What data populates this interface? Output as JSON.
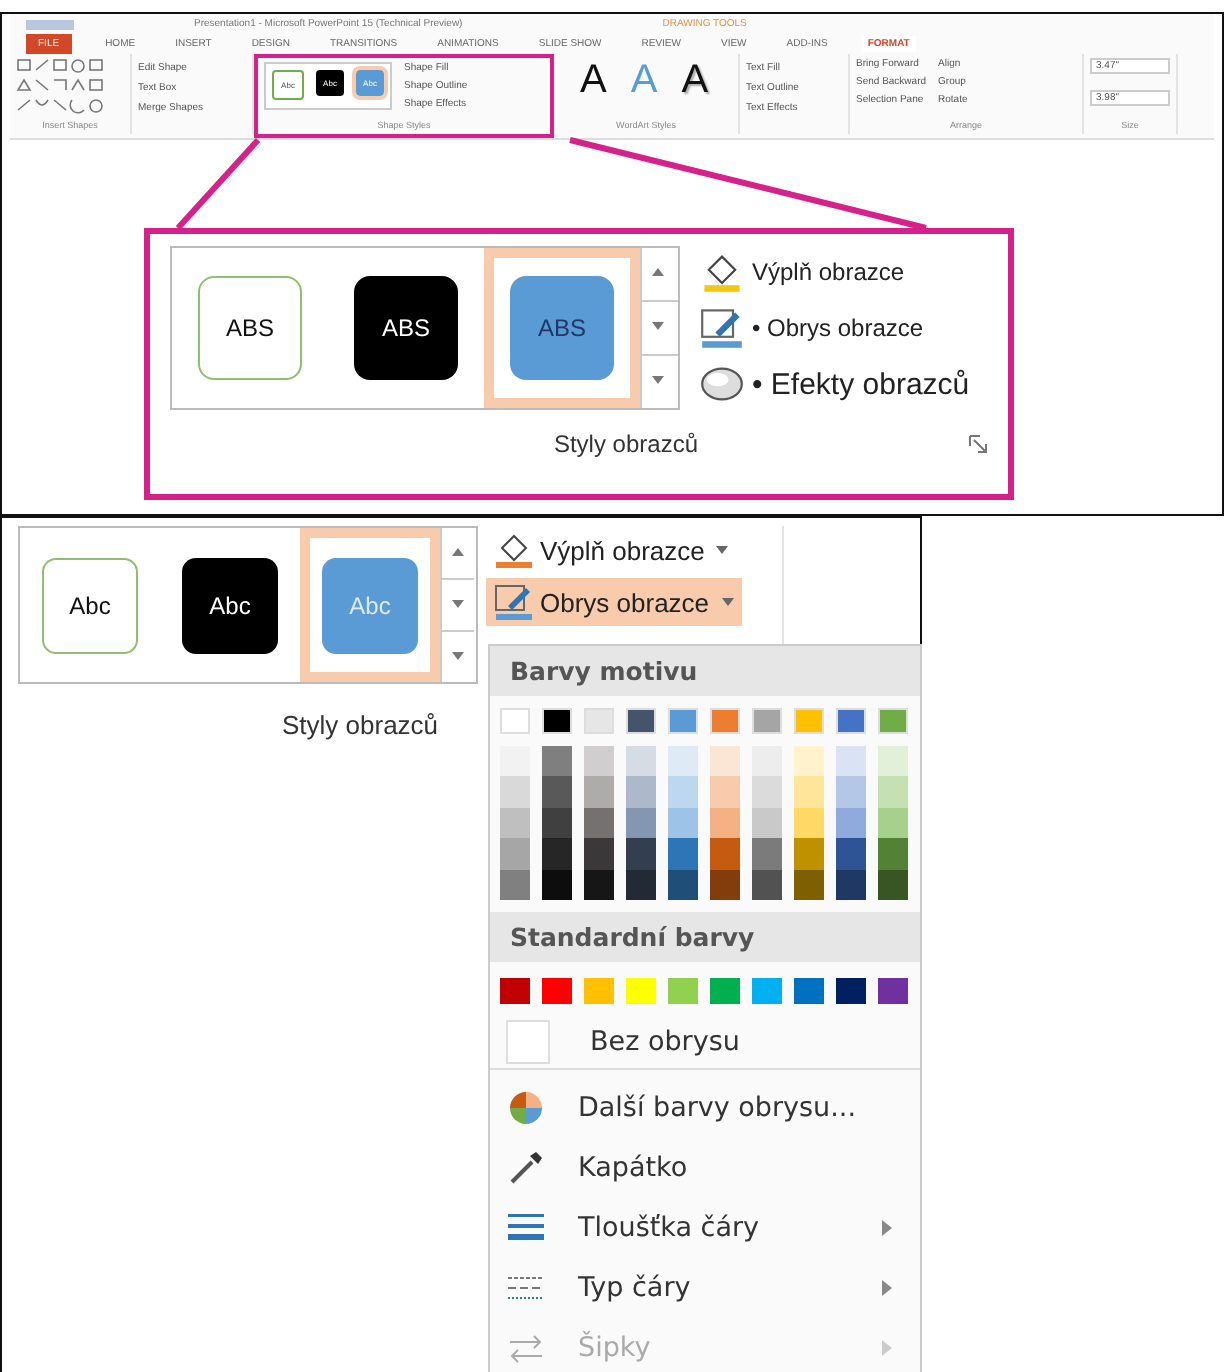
{
  "window": {
    "title": "Presentation1 - Microsoft PowerPoint 15 (Technical Preview)",
    "context_label": "DRAWING TOOLS"
  },
  "ribbon_tabs": [
    {
      "label": "FILE",
      "kind": "file",
      "selected": false
    },
    {
      "label": "HOME",
      "kind": "tab",
      "selected": false
    },
    {
      "label": "INSERT",
      "kind": "tab",
      "selected": false
    },
    {
      "label": "DESIGN",
      "kind": "tab",
      "selected": false
    },
    {
      "label": "TRANSITIONS",
      "kind": "tab",
      "selected": false
    },
    {
      "label": "ANIMATIONS",
      "kind": "tab",
      "selected": false
    },
    {
      "label": "SLIDE SHOW",
      "kind": "tab",
      "selected": false
    },
    {
      "label": "REVIEW",
      "kind": "tab",
      "selected": false
    },
    {
      "label": "VIEW",
      "kind": "tab",
      "selected": false
    },
    {
      "label": "ADD-INS",
      "kind": "tab",
      "selected": false
    },
    {
      "label": "FORMAT",
      "kind": "tab",
      "selected": true
    }
  ],
  "mini_ribbon": {
    "edit_commands": [
      "Edit Shape",
      "Text Box",
      "Merge Shapes"
    ],
    "gallery": [
      "Abc",
      "Abc",
      "Abc"
    ],
    "style_commands": [
      "Shape Fill",
      "Shape Outline",
      "Shape Effects"
    ],
    "wordart": [
      "A",
      "A",
      "A"
    ],
    "text_commands": [
      "Text Fill",
      "Text Outline",
      "Text Effects"
    ],
    "arrange_commands": [
      "Bring Forward",
      "Send Backward",
      "Selection Pane"
    ],
    "arrange_commands_2": [
      "Align",
      "Group",
      "Rotate"
    ],
    "size": [
      "3.47\"",
      "3.98\""
    ],
    "group_labels": [
      "Insert Shapes",
      "Shape Styles",
      "WordArt Styles",
      "Arrange",
      "Size"
    ]
  },
  "zoomed_group": {
    "styles": [
      {
        "label": "ABS",
        "kind": "outline",
        "selected": false
      },
      {
        "label": "ABS",
        "kind": "black",
        "selected": false
      },
      {
        "label": "ABS",
        "kind": "blue",
        "selected": true
      }
    ],
    "commands": [
      {
        "label": "Výplň obrazce",
        "kind": "fill"
      },
      {
        "label": "• Obrys obrazce",
        "kind": "outline"
      },
      {
        "label": "• Efekty obrazců",
        "kind": "effects"
      }
    ],
    "group_label": "Styly obrazců"
  },
  "lower_group": {
    "styles": [
      {
        "label": "Abc",
        "kind": "outline",
        "selected": false
      },
      {
        "label": "Abc",
        "kind": "black",
        "selected": false
      },
      {
        "label": "Abc",
        "kind": "blue",
        "selected": true
      }
    ],
    "commands": [
      {
        "label": "Výplň obrazce",
        "kind": "fill",
        "selected": false
      },
      {
        "label": "Obrys obrazce",
        "kind": "outline",
        "selected": true
      }
    ],
    "group_label": "Styly obrazců"
  },
  "outline_menu": {
    "theme_heading": "Barvy motivu",
    "theme_colors": [
      {
        "color": "#ffffff",
        "shades": [
          {
            "color": "#f2f2f2"
          },
          {
            "color": "#d9d9d9"
          },
          {
            "color": "#bfbfbf"
          },
          {
            "color": "#a6a6a6"
          },
          {
            "color": "#808080"
          }
        ]
      },
      {
        "color": "#000000",
        "shades": [
          {
            "color": "#7f7f7f"
          },
          {
            "color": "#595959"
          },
          {
            "color": "#404040"
          },
          {
            "color": "#262626"
          },
          {
            "color": "#0d0d0d"
          }
        ]
      },
      {
        "color": "#e7e6e6",
        "shades": [
          {
            "color": "#d0cece"
          },
          {
            "color": "#aeabab"
          },
          {
            "color": "#757171"
          },
          {
            "color": "#3a3838"
          },
          {
            "color": "#171616"
          }
        ]
      },
      {
        "color": "#44546a",
        "shades": [
          {
            "color": "#d6dce4"
          },
          {
            "color": "#adb9ca"
          },
          {
            "color": "#8497b0"
          },
          {
            "color": "#333f4f"
          },
          {
            "color": "#222a35"
          }
        ]
      },
      {
        "color": "#5b9bd5",
        "shades": [
          {
            "color": "#deebf6"
          },
          {
            "color": "#bdd7ee"
          },
          {
            "color": "#9dc3e6"
          },
          {
            "color": "#2e75b5"
          },
          {
            "color": "#1f4e79"
          }
        ]
      },
      {
        "color": "#ed7d31",
        "shades": [
          {
            "color": "#fbe5d5"
          },
          {
            "color": "#f7cbac"
          },
          {
            "color": "#f4b183"
          },
          {
            "color": "#c55a11"
          },
          {
            "color": "#833c0b"
          }
        ]
      },
      {
        "color": "#a5a5a5",
        "shades": [
          {
            "color": "#ededed"
          },
          {
            "color": "#dbdbdb"
          },
          {
            "color": "#c9c9c9"
          },
          {
            "color": "#7b7b7b"
          },
          {
            "color": "#525252"
          }
        ]
      },
      {
        "color": "#ffc000",
        "shades": [
          {
            "color": "#fff2cc"
          },
          {
            "color": "#fee599"
          },
          {
            "color": "#ffd965"
          },
          {
            "color": "#bf9000"
          },
          {
            "color": "#7f6000"
          }
        ]
      },
      {
        "color": "#4472c4",
        "shades": [
          {
            "color": "#dae3f3"
          },
          {
            "color": "#b4c7e7"
          },
          {
            "color": "#8faadc"
          },
          {
            "color": "#2f5496"
          },
          {
            "color": "#1f3864"
          }
        ]
      },
      {
        "color": "#70ad47",
        "shades": [
          {
            "color": "#e2efd9"
          },
          {
            "color": "#c5e0b3"
          },
          {
            "color": "#a8d08d"
          },
          {
            "color": "#538135"
          },
          {
            "color": "#375623"
          }
        ]
      }
    ],
    "standard_heading": "Standardní barvy",
    "standard_colors": [
      {
        "color": "#c00000"
      },
      {
        "color": "#ff0000"
      },
      {
        "color": "#ffc000"
      },
      {
        "color": "#ffff00"
      },
      {
        "color": "#92d050"
      },
      {
        "color": "#00b050"
      },
      {
        "color": "#00b0f0"
      },
      {
        "color": "#0070c0"
      },
      {
        "color": "#002060"
      },
      {
        "color": "#7030a0"
      }
    ],
    "items": [
      {
        "label": "Bez obrysu",
        "kind": "no-outline",
        "submenu": false,
        "disabled": false
      },
      {
        "label": "Další barvy obrysu...",
        "kind": "more-colors",
        "submenu": false,
        "disabled": false
      },
      {
        "label": "Kapátko",
        "kind": "eyedropper",
        "submenu": false,
        "disabled": false
      },
      {
        "label": "Tloušťka čáry",
        "kind": "weight",
        "submenu": true,
        "disabled": false
      },
      {
        "label": "Typ čáry",
        "kind": "dash",
        "submenu": true,
        "disabled": false
      },
      {
        "label": "Šipky",
        "kind": "arrows",
        "submenu": true,
        "disabled": true
      }
    ]
  }
}
